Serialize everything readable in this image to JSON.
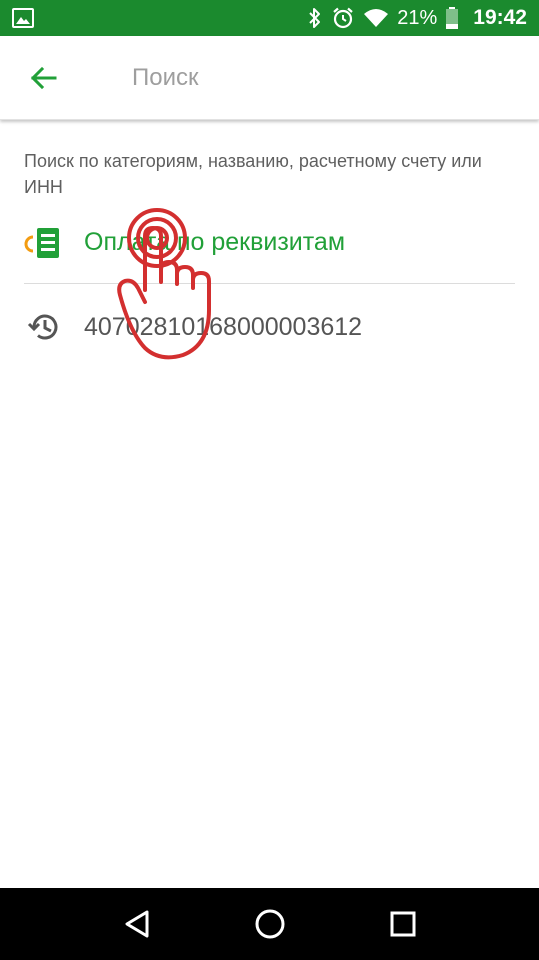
{
  "status_bar": {
    "battery_percent": "21%",
    "time": "19:42",
    "icons": [
      "gallery-icon",
      "bluetooth-icon",
      "alarm-icon",
      "wifi-icon",
      "battery-icon"
    ]
  },
  "toolbar": {
    "back_icon": "arrow-left-icon",
    "search_placeholder": "Поиск",
    "accent_color": "#21a038"
  },
  "hint": "Поиск по категориям, названию, расчетному счету или ИНН",
  "results": [
    {
      "icon": "document-payment-icon",
      "label": "Оплата по реквизитам",
      "color": "#21a038"
    },
    {
      "icon": "history-icon",
      "label": "40702810168000003612",
      "color": "#555555"
    }
  ],
  "overlay": {
    "icon": "tap-hand-icon",
    "color": "#d32f2f"
  },
  "nav_bar": {
    "icons": [
      "back-triangle-icon",
      "home-circle-icon",
      "recents-square-icon"
    ]
  },
  "colors": {
    "status_bar": "#1b8a2e",
    "primary_green": "#21a038"
  }
}
